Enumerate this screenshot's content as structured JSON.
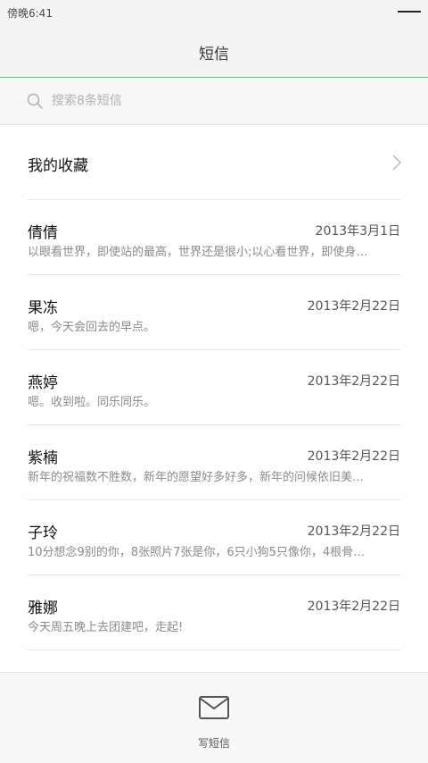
{
  "status_bar": {
    "time": "傍晚6:41"
  },
  "header": {
    "title": "短信"
  },
  "search": {
    "placeholder": "搜索8条短信",
    "value": ""
  },
  "favorites": {
    "label": "我的收藏"
  },
  "messages": [
    {
      "name": "倩倩",
      "date": "2013年3月1日",
      "preview": "以眼看世界，即使站的最高，世界还是很小;以心看世界，即使身…",
      "unread": false
    },
    {
      "name": "果冻",
      "date": "2013年2月22日",
      "preview": "嗯，今天会回去的早点。",
      "unread": false
    },
    {
      "name": "燕婷",
      "date": "2013年2月22日",
      "preview": "嗯。收到啦。同乐同乐。",
      "unread": true
    },
    {
      "name": "紫楠",
      "date": "2013年2月22日",
      "preview": "新年的祝福数不胜数，新年的愿望好多好多，新年的问候依旧美…",
      "unread": false
    },
    {
      "name": "子玲",
      "date": "2013年2月22日",
      "preview": "10分想念9别的你，8张照片7张是你，6只小狗5只像你，4根骨…",
      "unread": false
    },
    {
      "name": "雅娜",
      "date": "2013年2月22日",
      "preview": "今天周五晚上去团建吧，走起!",
      "unread": false
    }
  ],
  "bottom": {
    "compose_label": "写短信"
  },
  "colors": {
    "accent": "#1ec66a",
    "header_border": "#4fc47a"
  }
}
